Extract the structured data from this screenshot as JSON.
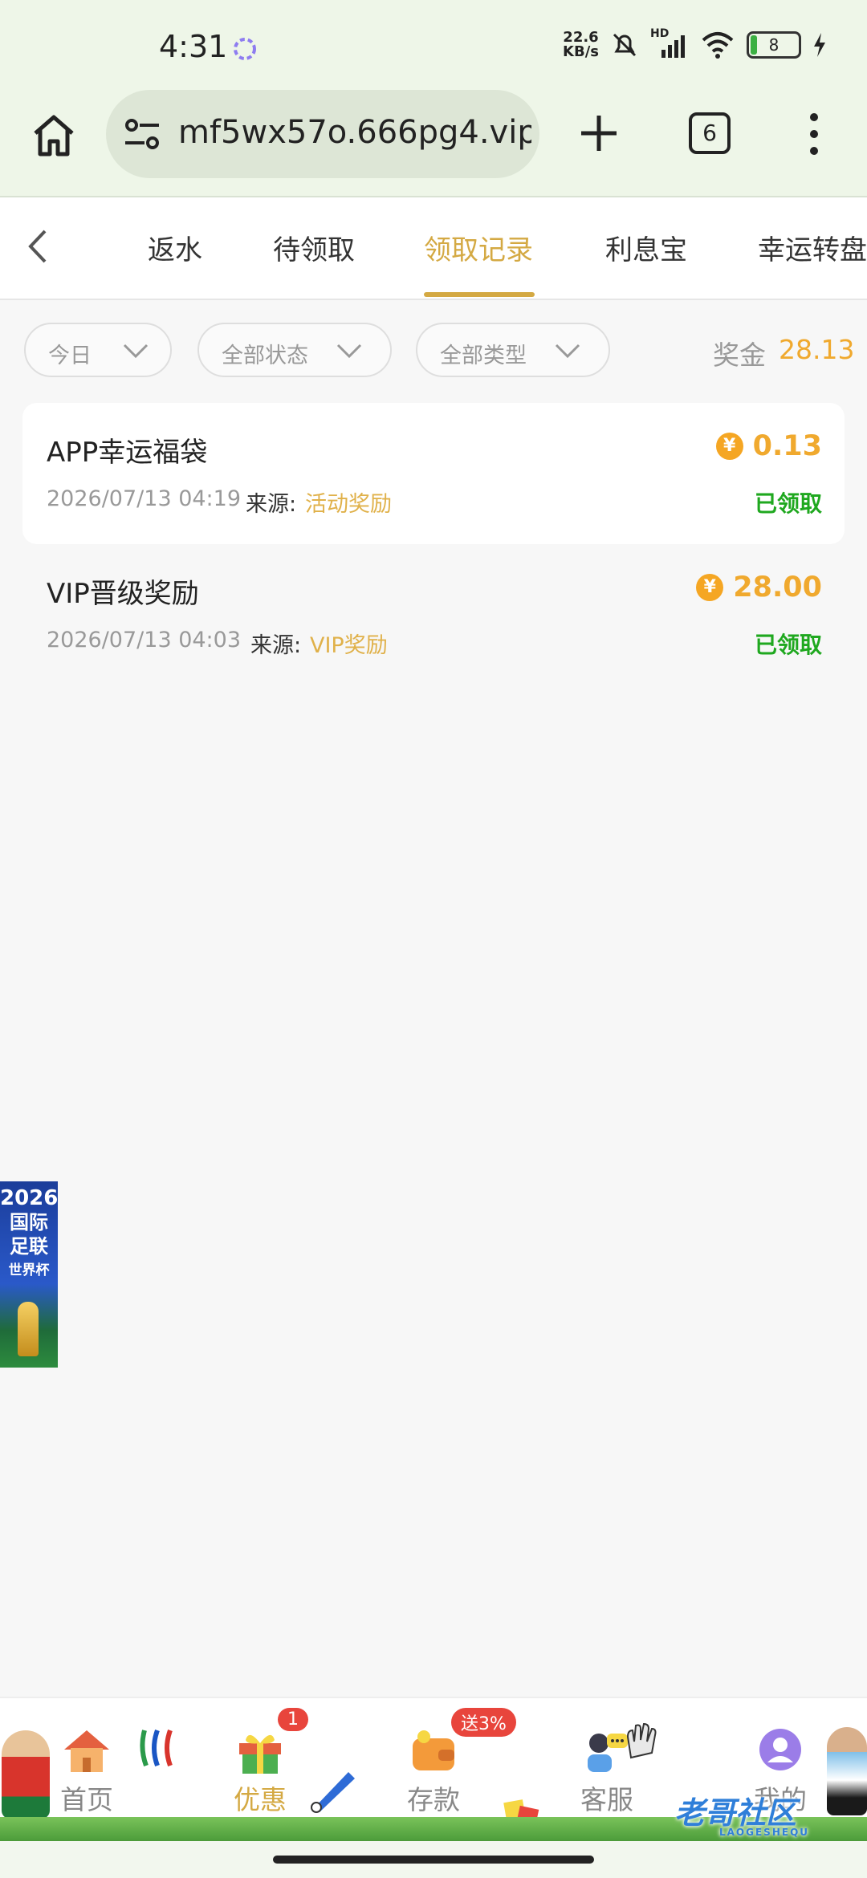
{
  "status_bar": {
    "time": "4:31",
    "net_speed_value": "22.6",
    "net_speed_unit": "KB/s",
    "network_label": "HD",
    "battery": "8"
  },
  "browser": {
    "url": "mf5wx57o.666pg4.vip",
    "tab_count": "6"
  },
  "nav_tabs": {
    "items": [
      {
        "label": "返水"
      },
      {
        "label": "待领取"
      },
      {
        "label": "领取记录"
      },
      {
        "label": "利息宝"
      },
      {
        "label": "幸运转盘"
      }
    ],
    "active_index": 2
  },
  "filters": {
    "date": "今日",
    "status": "全部状态",
    "type": "全部类型",
    "bonus_label": "奖金",
    "bonus_total": "28.13"
  },
  "records": [
    {
      "title": "APP幸运福袋",
      "date": "2026/07/13 04:19",
      "source_label": "来源:",
      "source": "活动奖励",
      "amount": "0.13",
      "status": "已领取"
    },
    {
      "title": "VIP晋级奖励",
      "date": "2026/07/13 04:03",
      "source_label": "来源:",
      "source": "VIP奖励",
      "amount": "28.00",
      "status": "已领取"
    }
  ],
  "coin_symbol": "¥",
  "side_banner": {
    "year": "2026",
    "line1": "国际",
    "line2": "足联",
    "line3": "世界杯"
  },
  "bottom_nav": {
    "items": [
      {
        "label": "首页"
      },
      {
        "label": "优惠",
        "badge": "1"
      },
      {
        "label": "存款",
        "badge": "送3%"
      },
      {
        "label": "客服"
      },
      {
        "label": "我的"
      }
    ],
    "active_index": 1
  },
  "watermark": {
    "text": "老哥社区",
    "sub": "LAOGESHEQU"
  },
  "colors": {
    "accent_gold": "#d4a943",
    "amount_orange": "#f0a92e",
    "status_green": "#1fa81f",
    "badge_red": "#e8453c"
  }
}
